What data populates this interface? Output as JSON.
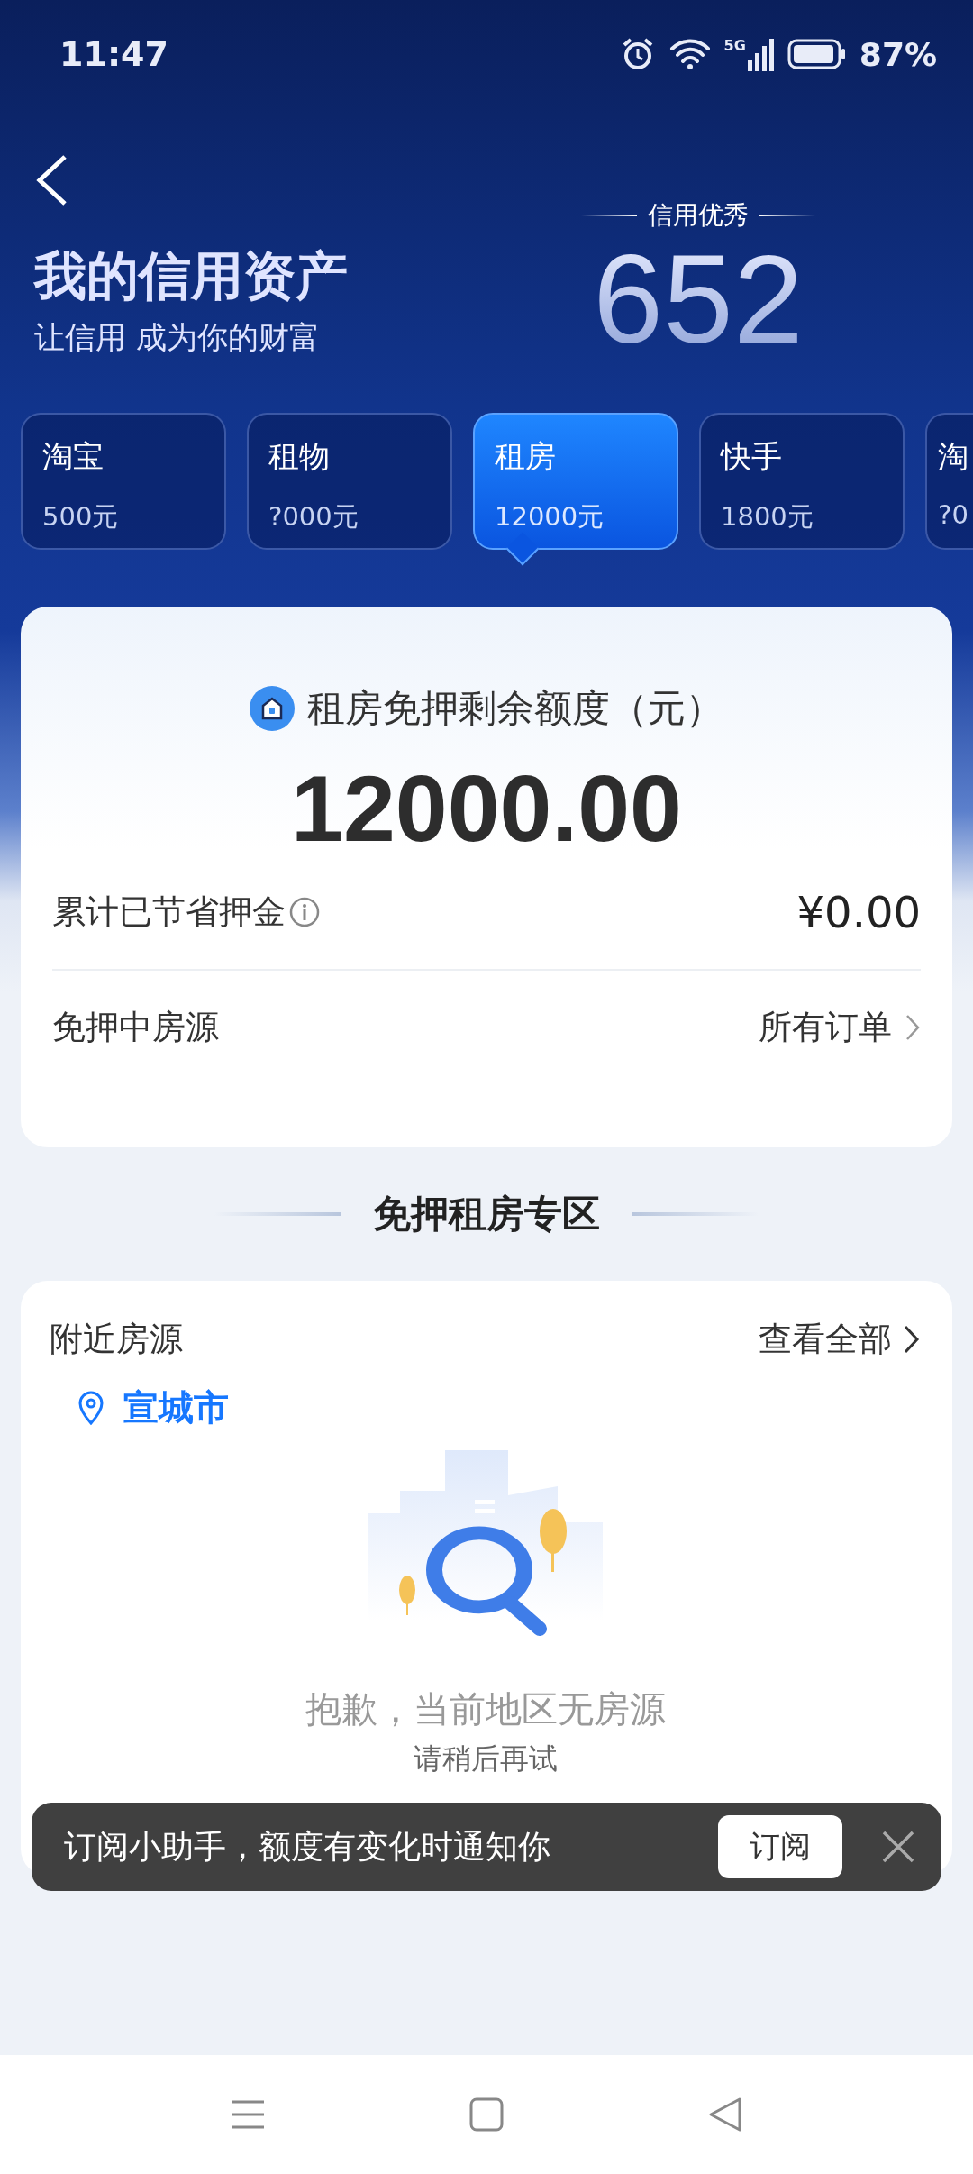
{
  "status_bar": {
    "time": "11:47",
    "network": "5G",
    "battery": "87%"
  },
  "header": {
    "title": "我的信用资产",
    "subtitle": "让信用 成为你的财富",
    "credit_label": "信用优秀",
    "credit_score": "652"
  },
  "tabs": [
    {
      "name": "淘宝",
      "amount": "500元",
      "selected": false
    },
    {
      "name": "租物",
      "amount": "?000元",
      "selected": false
    },
    {
      "name": "租房",
      "amount": "12000元",
      "selected": true
    },
    {
      "name": "快手",
      "amount": "1800元",
      "selected": false
    },
    {
      "name": "淘",
      "amount": "?0",
      "selected": false
    }
  ],
  "quota_card": {
    "title": "租房免押剩余额度（元）",
    "amount": "12000.00",
    "rows": [
      {
        "label": "累计已节省押金",
        "value": "¥0.00",
        "info": true,
        "link": false
      },
      {
        "label": "免押中房源",
        "value": "所有订单",
        "info": false,
        "link": true
      }
    ]
  },
  "section_title": "免押租房专区",
  "nearby": {
    "title": "附近房源",
    "view_all": "查看全部",
    "city": "宣城市",
    "empty_message": "抱歉，当前地区无房源",
    "empty_hint": "请稍后再试"
  },
  "toast": {
    "message": "订阅小助手，额度有变化时通知你",
    "button": "订阅"
  }
}
